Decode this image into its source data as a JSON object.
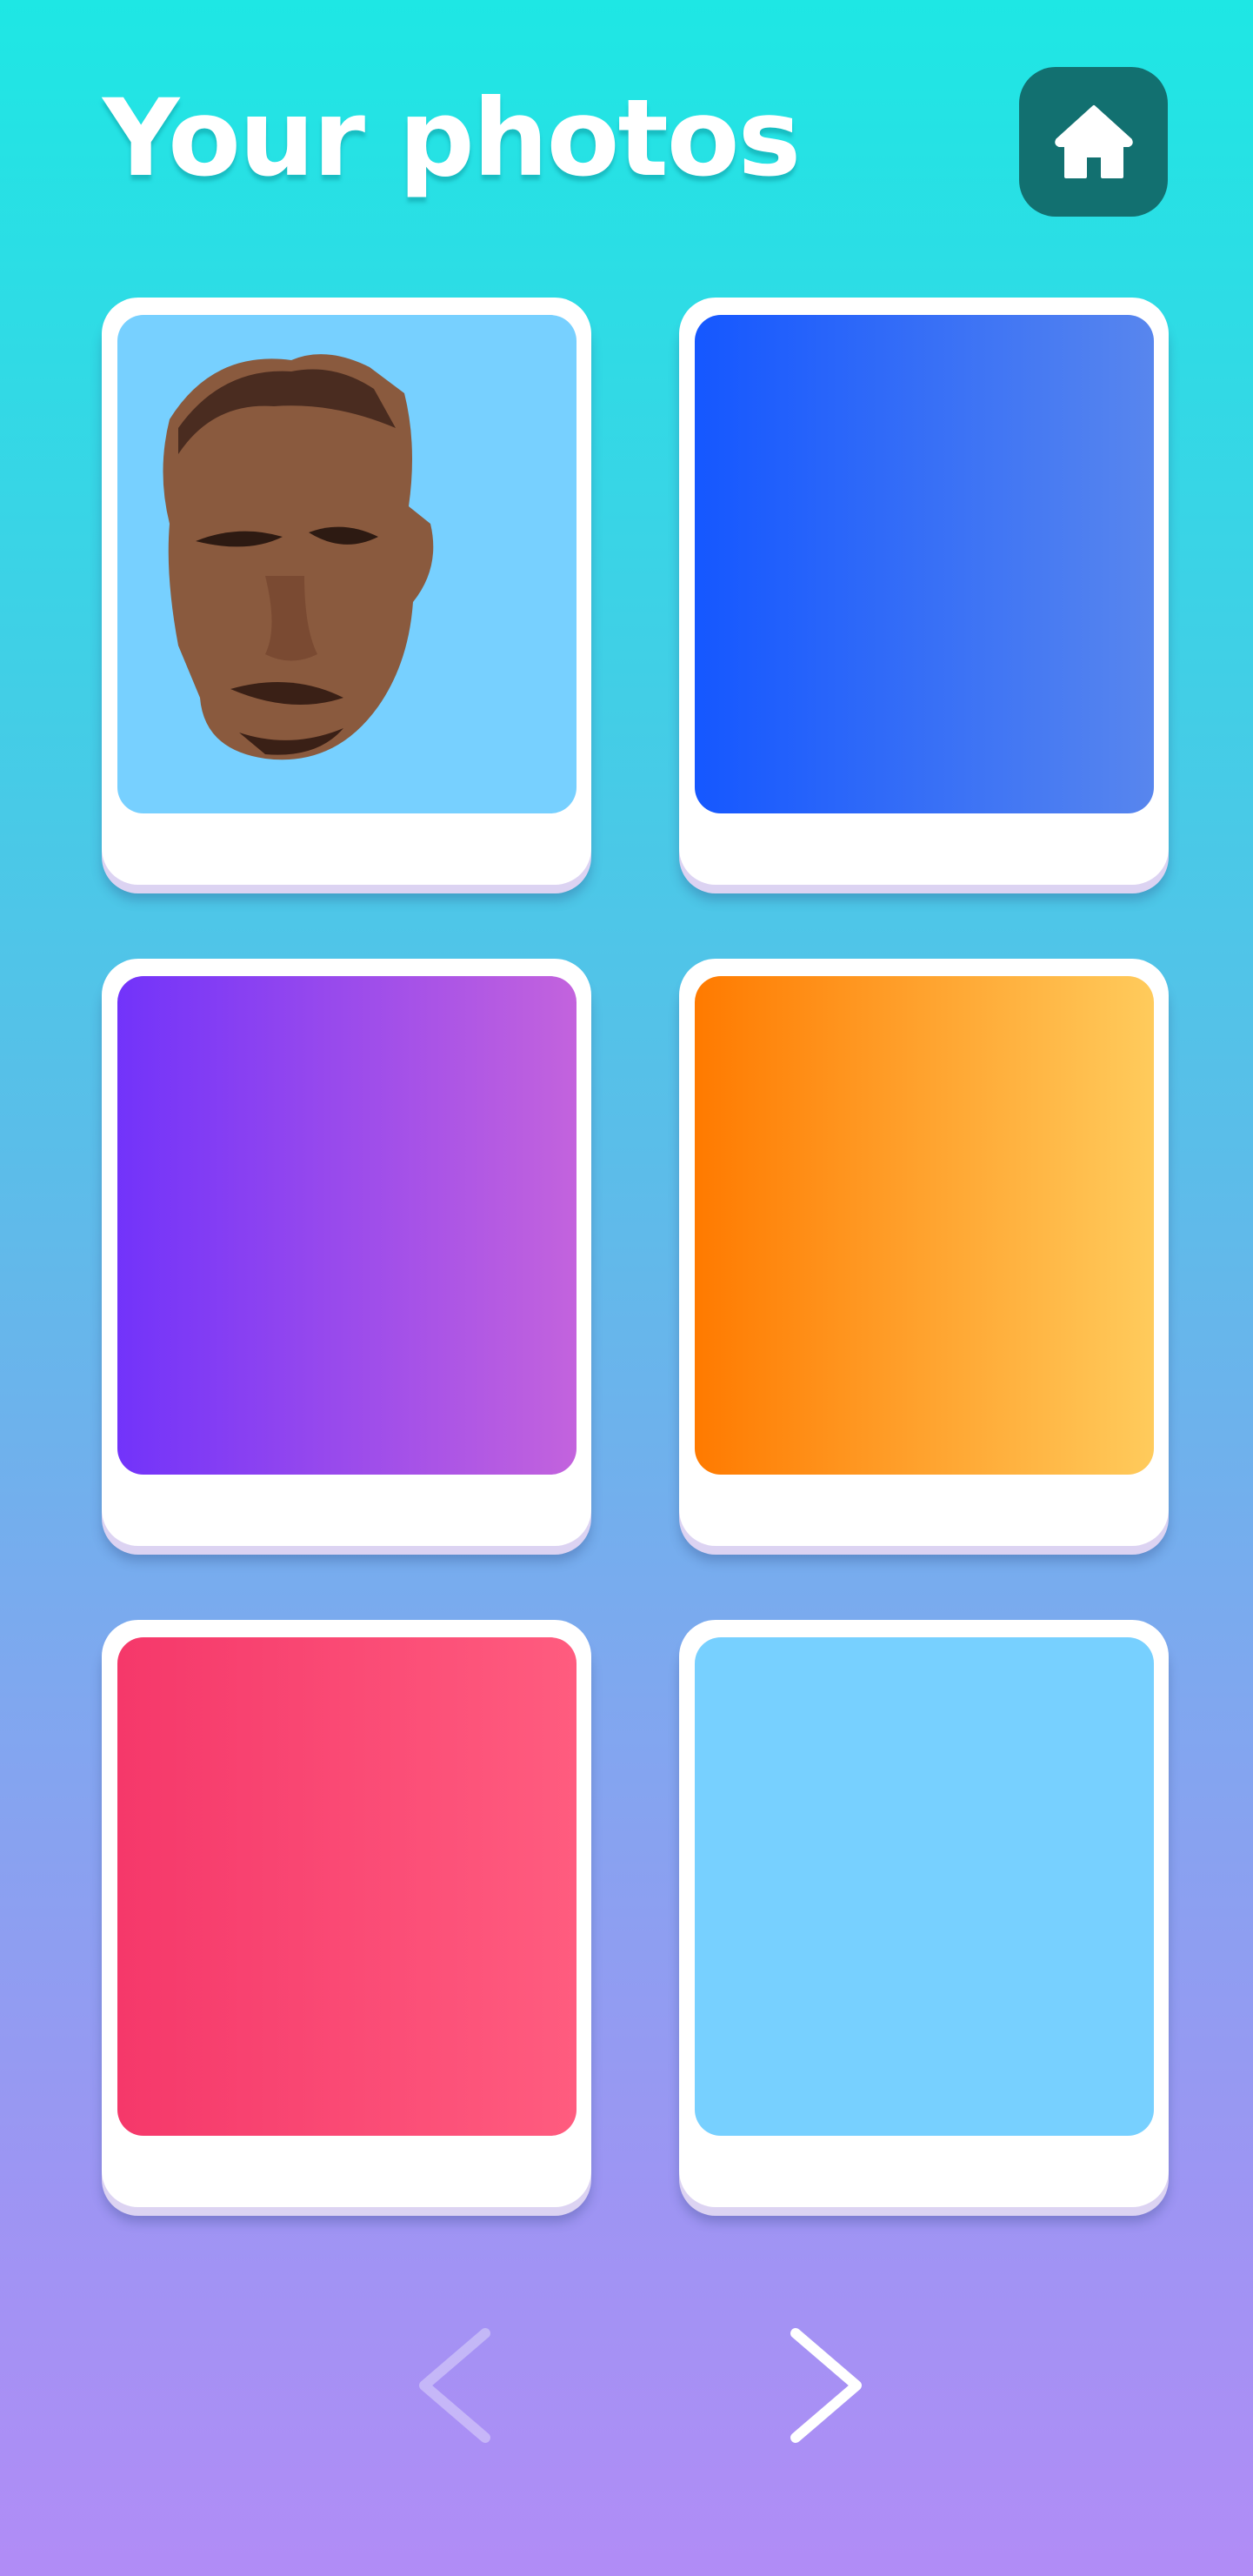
{
  "header": {
    "title": "Your photos",
    "home_icon": "home-icon"
  },
  "photos": [
    {
      "kind": "face-photo",
      "bg": "#77d0ff"
    },
    {
      "kind": "gradient",
      "from": "#1557ff",
      "to": "#5886ee"
    },
    {
      "kind": "gradient",
      "from": "#7233fa",
      "to": "#c363dd"
    },
    {
      "kind": "gradient",
      "from": "#ff7a00",
      "to": "#ffcb5c"
    },
    {
      "kind": "gradient",
      "from": "#f5386a",
      "to": "#ff5c7f"
    },
    {
      "kind": "solid",
      "from": "#77d0ff",
      "to": "#77d0ff"
    }
  ],
  "pagination": {
    "prev_enabled": false,
    "next_enabled": true
  }
}
